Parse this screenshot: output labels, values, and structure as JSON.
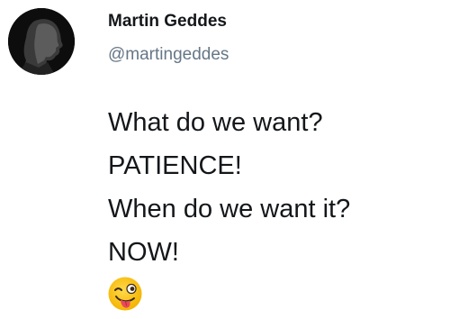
{
  "tweet": {
    "author": {
      "display_name": "Martin Geddes",
      "handle": "@martingeddes",
      "avatar_icon": "profile-photo"
    },
    "text_lines": [
      "What do we want?",
      "PATIENCE!",
      "When do we want it?",
      "NOW!"
    ],
    "emoji": "winking-face-with-tongue"
  },
  "colors": {
    "text": "#14171a",
    "secondary_text": "#657786",
    "background": "#ffffff",
    "emoji_face": "#f7c21b"
  }
}
